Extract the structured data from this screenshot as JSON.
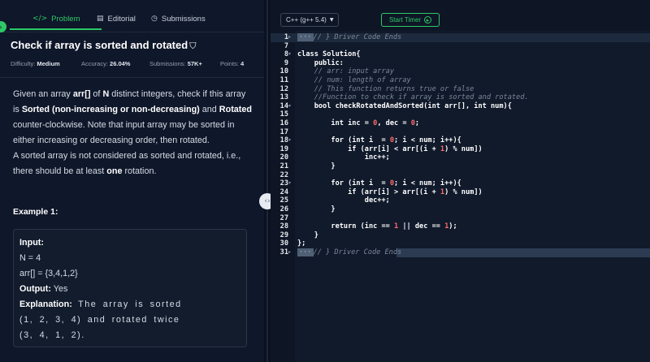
{
  "tabs": [
    {
      "label": "Problem",
      "icon": "code-icon",
      "glyph": "</>"
    },
    {
      "label": "Editorial",
      "icon": "document-icon",
      "glyph": "▤"
    },
    {
      "label": "Submissions",
      "icon": "clock-icon",
      "glyph": "◷"
    }
  ],
  "problem": {
    "title": "Check if array is sorted and rotated",
    "bookmark_glyph": "⛉",
    "difficulty_label": "Difficulty:",
    "difficulty": "Medium",
    "accuracy_label": "Accuracy:",
    "accuracy": "26.04%",
    "submissions_label": "Submissions:",
    "submissions": "57K+",
    "points_label": "Points:",
    "points": "4",
    "desc": {
      "p1": "Given an array ",
      "arr": "arr[]",
      "p2": " of ",
      "n": "N",
      "p3": " distinct integers, check if this array is ",
      "sorted": "Sorted (non-increasing or non-decreasing)",
      "p4": " and ",
      "rotated": "Rotated",
      "p5": " counter-clockwise. Note that input array may be sorted in either increasing or decreasing order, then rotated.",
      "p6": "A sorted array is not considered as sorted and rotated, i.e., there should be at least ",
      "one": "one",
      "p7": " rotation."
    },
    "example_title": "Example 1:",
    "example": {
      "input_label": "Input:",
      "n_line": "N = 4",
      "arr_line": "arr[] = {3,4,1,2}",
      "output_label": "Output:",
      "output": "Yes",
      "explanation_label": "Explanation:",
      "explanation_1": "The array is sorted",
      "explanation_2": "(1, 2, 3, 4) and rotated twice",
      "explanation_3": "(3, 4, 1, 2)."
    }
  },
  "editor": {
    "language": "C++ (g++ 5.4)",
    "dropdown_glyph": "▼",
    "timer_label": "Start Timer",
    "timer_glyph": "▸",
    "code_lines": [
      {
        "n": "1",
        "fold": "▸",
        "collapsed": "···",
        "text": "// } Driver Code Ends",
        "cls": "c-cmt",
        "hl": true
      },
      {
        "n": "7",
        "fold": "",
        "text": ""
      },
      {
        "n": "8",
        "fold": "▾",
        "text": "class Solution{"
      },
      {
        "n": "9",
        "fold": "",
        "text": "    public:"
      },
      {
        "n": "10",
        "fold": "",
        "text": "    // arr: input array",
        "cls": "c-cmt"
      },
      {
        "n": "11",
        "fold": "",
        "text": "    // num: length of array",
        "cls": "c-cmt"
      },
      {
        "n": "12",
        "fold": "",
        "text": "    // This function returns true or false",
        "cls": "c-cmt"
      },
      {
        "n": "13",
        "fold": "",
        "text": "    //Function to check if array is sorted and rotated.",
        "cls": "c-cmt"
      },
      {
        "n": "14",
        "fold": "▾",
        "text": "    bool checkRotatedAndSorted(int arr[], int num){"
      },
      {
        "n": "15",
        "fold": "",
        "text": ""
      },
      {
        "n": "16",
        "fold": "",
        "text": "        int inc = 0, dec = 0;"
      },
      {
        "n": "17",
        "fold": "",
        "text": ""
      },
      {
        "n": "18",
        "fold": "▾",
        "text": "        for (int i  = 0; i < num; i++){"
      },
      {
        "n": "19",
        "fold": "",
        "text": "            if (arr[i] < arr[(i + 1) % num])"
      },
      {
        "n": "20",
        "fold": "",
        "text": "                inc++;"
      },
      {
        "n": "21",
        "fold": "",
        "text": "        }"
      },
      {
        "n": "22",
        "fold": "",
        "text": ""
      },
      {
        "n": "23",
        "fold": "▾",
        "text": "        for (int i  = 0; i < num; i++){"
      },
      {
        "n": "24",
        "fold": "",
        "text": "            if (arr[i] > arr[(i + 1) % num])"
      },
      {
        "n": "25",
        "fold": "",
        "text": "                dec++;"
      },
      {
        "n": "26",
        "fold": "",
        "text": "        }"
      },
      {
        "n": "27",
        "fold": "",
        "text": ""
      },
      {
        "n": "28",
        "fold": "",
        "text": "        return (inc == 1 || dec == 1);"
      },
      {
        "n": "29",
        "fold": "",
        "text": "    }"
      },
      {
        "n": "30",
        "fold": "",
        "text": "};"
      },
      {
        "n": "31",
        "fold": "▸",
        "collapsed": "···",
        "text": "// } Driver Code Ends",
        "cls": "c-cmt",
        "hl": true,
        "last": true
      }
    ]
  },
  "colors": {
    "accent": "#2ec866",
    "bg": "#0f172a",
    "editor_bg": "#101a2b"
  }
}
